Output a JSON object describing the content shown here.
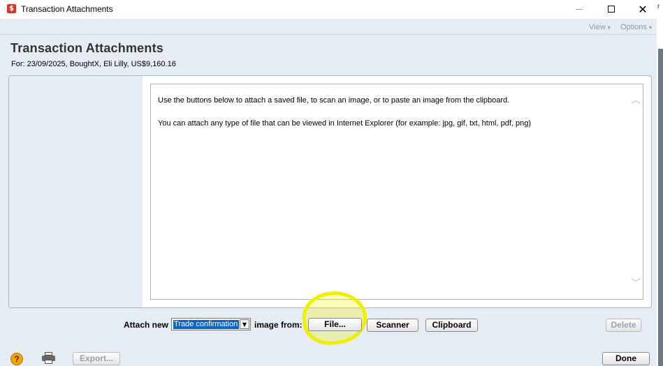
{
  "window": {
    "title": "Transaction Attachments",
    "app_icon": "$",
    "close_glyph": "✕",
    "edge_letter": "r"
  },
  "menu": {
    "view": "View",
    "options": "Options",
    "arrow": "▾"
  },
  "header": {
    "title": "Transaction Attachments",
    "subtitle": "For: 23/09/2025,  BoughtX,  Eli Lilly,  US$9,160.16"
  },
  "viewer": {
    "line1": "Use the buttons below to attach a saved file, to scan an image, or to paste an image from the clipboard.",
    "line2": "You can attach any type of file that can be viewed in Internet Explorer (for example: jpg, gif, txt, html, pdf, png)",
    "scroll_up": "︿",
    "scroll_down": "﹀"
  },
  "attach": {
    "label": "Attach new",
    "selected": "Trade confirmation",
    "drop_arrow": "▼",
    "image_from": "image from:",
    "file_button": "File...",
    "scanner_button": "Scanner",
    "clipboard_button": "Clipboard",
    "delete_button": "Delete"
  },
  "footer": {
    "help": "?",
    "export_button": "Export...",
    "done_button": "Done"
  },
  "colors": {
    "highlight": "#eef000",
    "selection": "#0a64c8",
    "background": "#e6ecf3"
  }
}
